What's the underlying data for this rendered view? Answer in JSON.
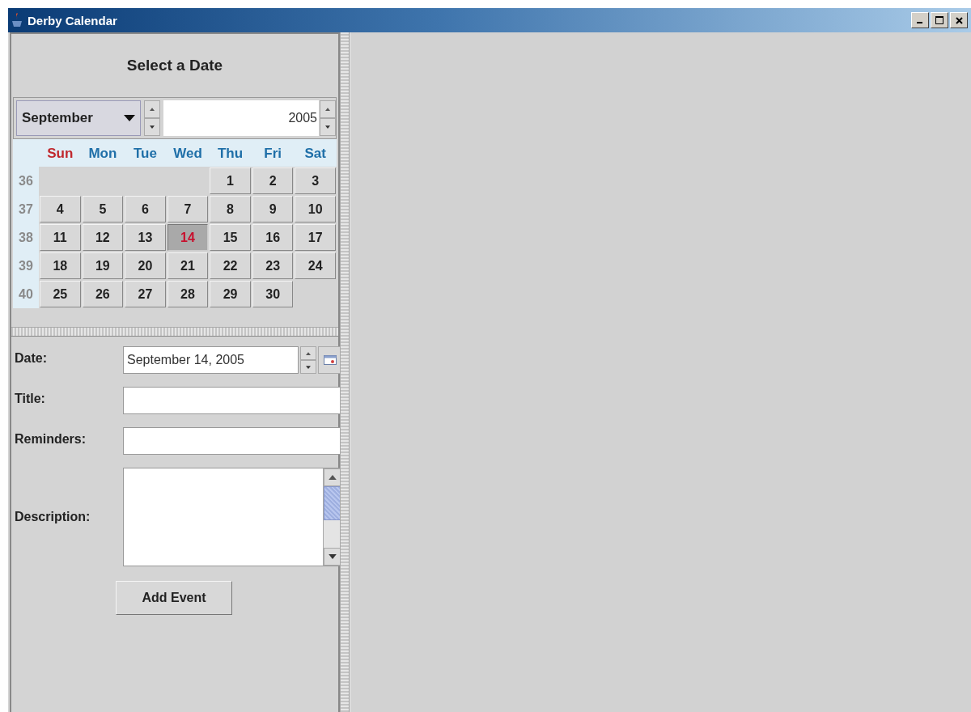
{
  "window": {
    "title": "Derby Calendar"
  },
  "calendar": {
    "heading": "Select a Date",
    "month": "September",
    "year": "2005",
    "weekdays": [
      {
        "label": "Sun",
        "color": "#c0282d"
      },
      {
        "label": "Mon",
        "color": "#1f6fa8"
      },
      {
        "label": "Tue",
        "color": "#1f6fa8"
      },
      {
        "label": "Wed",
        "color": "#1f6fa8"
      },
      {
        "label": "Thu",
        "color": "#1f6fa8"
      },
      {
        "label": "Fri",
        "color": "#1f6fa8"
      },
      {
        "label": "Sat",
        "color": "#1f6fa8"
      }
    ],
    "weeks": [
      {
        "number": "36",
        "days": [
          {
            "kind": "blank"
          },
          {
            "kind": "blank"
          },
          {
            "kind": "blank"
          },
          {
            "kind": "blank"
          },
          {
            "label": "1",
            "selected": false
          },
          {
            "label": "2",
            "selected": false
          },
          {
            "label": "3",
            "selected": false
          }
        ]
      },
      {
        "number": "37",
        "days": [
          {
            "label": "4",
            "selected": false
          },
          {
            "label": "5",
            "selected": false
          },
          {
            "label": "6",
            "selected": false
          },
          {
            "label": "7",
            "selected": false
          },
          {
            "label": "8",
            "selected": false
          },
          {
            "label": "9",
            "selected": false
          },
          {
            "label": "10",
            "selected": false
          }
        ]
      },
      {
        "number": "38",
        "days": [
          {
            "label": "11",
            "selected": false
          },
          {
            "label": "12",
            "selected": false
          },
          {
            "label": "13",
            "selected": false
          },
          {
            "label": "14",
            "selected": true
          },
          {
            "label": "15",
            "selected": false
          },
          {
            "label": "16",
            "selected": false
          },
          {
            "label": "17",
            "selected": false
          }
        ]
      },
      {
        "number": "39",
        "days": [
          {
            "label": "18",
            "selected": false
          },
          {
            "label": "19",
            "selected": false
          },
          {
            "label": "20",
            "selected": false
          },
          {
            "label": "21",
            "selected": false
          },
          {
            "label": "22",
            "selected": false
          },
          {
            "label": "23",
            "selected": false
          },
          {
            "label": "24",
            "selected": false
          }
        ]
      },
      {
        "number": "40",
        "days": [
          {
            "label": "25",
            "selected": false
          },
          {
            "label": "26",
            "selected": false
          },
          {
            "label": "27",
            "selected": false
          },
          {
            "label": "28",
            "selected": false
          },
          {
            "label": "29",
            "selected": false
          },
          {
            "label": "30",
            "selected": false
          },
          {
            "kind": "blank"
          }
        ]
      }
    ]
  },
  "form": {
    "fields": [
      {
        "kind": "date",
        "label": "Date:",
        "value": "September 14, 2005"
      },
      {
        "kind": "text",
        "label": "Title:"
      },
      {
        "kind": "text",
        "label": "Reminders:"
      },
      {
        "kind": "textarea",
        "label": "Description:"
      }
    ],
    "button": "Add Event"
  }
}
